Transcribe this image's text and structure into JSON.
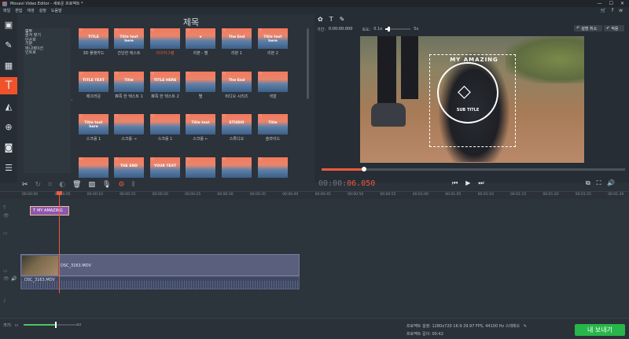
{
  "titlebar": {
    "title": "Movavi Video Editor - 새로운 프로젝트 *",
    "min": "—",
    "max": "☐",
    "close": "✕"
  },
  "menu": {
    "items": [
      "파일",
      "편집",
      "재생",
      "설정",
      "도움말"
    ]
  },
  "toolstrip": {
    "icons": [
      "film-import-icon",
      "magic-wand-icon",
      "filmstrip-icon",
      "text-icon",
      "shapes-icon",
      "zoom-icon",
      "circle-frame-icon",
      "list-icon"
    ]
  },
  "gallery": {
    "heading": "제목",
    "categories": [
      "모두",
      "즐겨 찾기",
      "단순화",
      "기본",
      "애니메이션",
      "인트로"
    ],
    "tiles": [
      {
        "overlay": "TITLE",
        "label": "3D 플랫카드"
      },
      {
        "overlay": "Title text here",
        "label": "간단한 텍스트"
      },
      {
        "overlay": "",
        "label": "다이어그램",
        "red": true
      },
      {
        "overlay": "★",
        "label": "리본 - 별"
      },
      {
        "overlay": "The End",
        "label": "리본 1"
      },
      {
        "overlay": "Title text here",
        "label": "리본 2"
      },
      {
        "overlay": "TITLE TEXT",
        "label": "매끄러운"
      },
      {
        "overlay": "Title",
        "label": "뾰족 한 텍스트 1"
      },
      {
        "overlay": "TITLE HERE",
        "label": "뾰족 한 텍스트 2"
      },
      {
        "overlay": "",
        "label": "별"
      },
      {
        "overlay": "The End",
        "label": "비디오 시리즈"
      },
      {
        "overlay": "",
        "label": "색깔"
      },
      {
        "overlay": "Title text here",
        "label": "스크롤 1"
      },
      {
        "overlay": "",
        "label": "스크롤 →"
      },
      {
        "overlay": "",
        "label": "스크롤 1"
      },
      {
        "overlay": "Title text",
        "label": "스크롤 ←"
      },
      {
        "overlay": "STUDIO",
        "label": "스튜디오"
      },
      {
        "overlay": "Title",
        "label": "슬라이드"
      },
      {
        "overlay": "",
        "label": ""
      },
      {
        "overlay": "THE END",
        "label": ""
      },
      {
        "overlay": "YOUR TEXT",
        "label": ""
      },
      {
        "overlay": "",
        "label": ""
      },
      {
        "overlay": "",
        "label": ""
      },
      {
        "overlay": "",
        "label": ""
      }
    ]
  },
  "preview": {
    "duration_label": "기간:",
    "duration_value": "0:00:00:000",
    "speed_label": "속도:",
    "speed_min": "0.1x",
    "speed_max": "5x",
    "cancel_label": "설명 취소",
    "apply_label": "적용",
    "overlay_title": "MY AMAZING",
    "overlay_sub": "SUB TITLE",
    "progress": 0.14
  },
  "timecode": {
    "dim": "00:00:",
    "hi": "06.050"
  },
  "ruler": {
    "ticks": [
      "00:00:00",
      "00:00:05",
      "00:00:10",
      "00:00:15",
      "00:00:20",
      "00:00:25",
      "00:00:30",
      "00:00:35",
      "00:00:40",
      "00:00:45",
      "00:00:50",
      "00:00:55",
      "00:01:00",
      "00:01:05",
      "00:01:10",
      "00:01:15",
      "00:01:20",
      "00:01:25",
      "00:01:30",
      "00:01:35"
    ]
  },
  "timeline": {
    "title_clip": "MY AMAZING",
    "video_clip": "DSC_3163.MOV",
    "audio_clip": "DSC_3163.MOV"
  },
  "bottom": {
    "zoom_label": "크기:",
    "zoom_level": 0.57,
    "project_settings_label": "프로젝트 설정:",
    "project_settings_value": "1280x720 16:9 29.97 FPS, 44100 Hz 스테레오",
    "project_length_label": "프로젝트 길이:",
    "project_length_value": "00:42",
    "export_label": "내 보내기"
  },
  "colors": {
    "accent": "#f05a3c",
    "export": "#28b64a",
    "title_clip": "#8e56b0"
  }
}
